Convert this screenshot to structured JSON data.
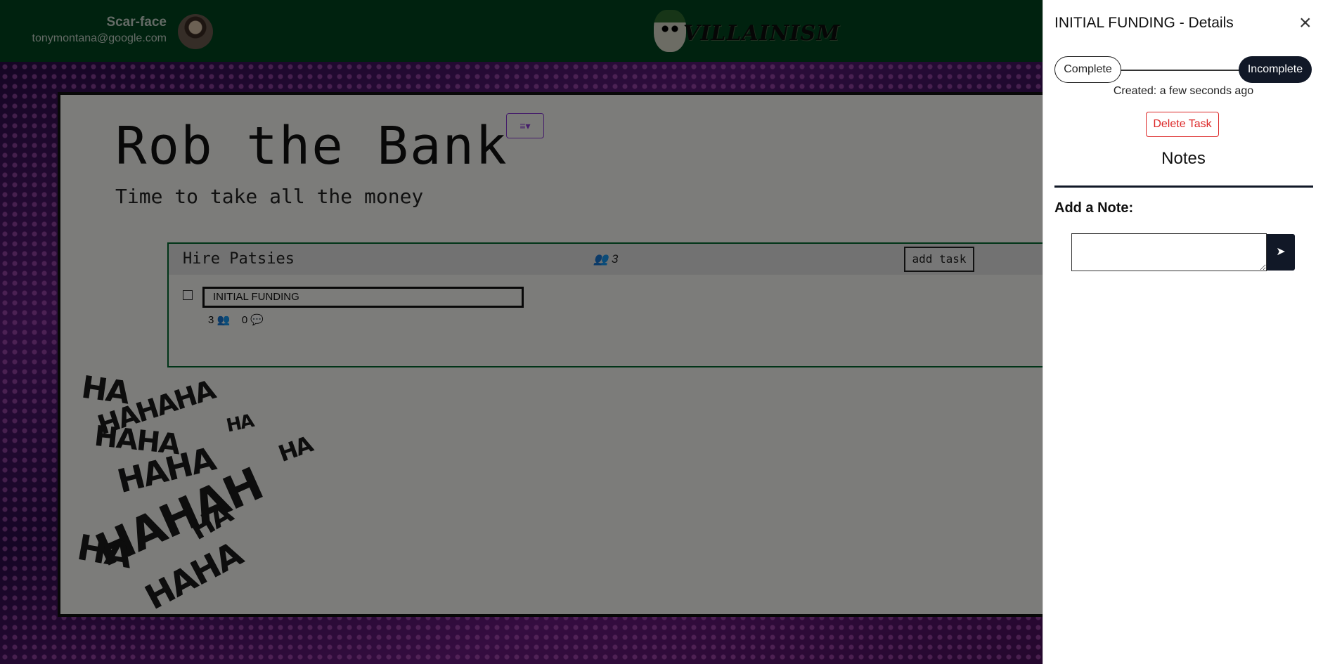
{
  "header": {
    "user_name": "Scar-face",
    "user_email": "tonymontana@google.com",
    "logo_text": "VILLAINISM"
  },
  "board": {
    "title": "Rob the Bank",
    "subtitle": "Time to take all the money",
    "menu_icon": "≡▾"
  },
  "group": {
    "title": "Hire Patsies",
    "member_count": "3",
    "add_task_label": "add task",
    "task": {
      "name": "INITIAL FUNDING",
      "members": "3",
      "comments": "0"
    }
  },
  "decor": {
    "haha": [
      "HA",
      "HAHAHA",
      "HA",
      "HA",
      "HAHA",
      "HAHA",
      "HAHAH",
      "HA",
      "HA",
      "HAHA"
    ]
  },
  "panel": {
    "title": "INITIAL FUNDING - Details",
    "close_icon": "×",
    "complete_label": "Complete",
    "incomplete_label": "Incomplete",
    "created_text": "Created: a few seconds ago",
    "delete_label": "Delete Task",
    "notes_title": "Notes",
    "add_note_label": "Add a Note:",
    "send_icon": "➤",
    "note_value": ""
  },
  "colors": {
    "header_green": "#00441e",
    "group_border": "#00692f",
    "panel_dark": "#111827",
    "delete_red": "#dc2626",
    "menu_purple": "#8b3bd6"
  }
}
